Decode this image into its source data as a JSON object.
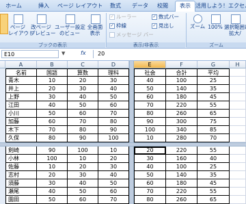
{
  "tabs": [
    "ホーム",
    "挿入",
    "ページ レイアウト",
    "数式",
    "データ",
    "校閲",
    "表示",
    "活用しよう！エクセル"
  ],
  "ribbon": {
    "view_buttons": [
      "標準",
      "ページ\nレイアウト",
      "改ページ\nプレビュー",
      "ユーザー設定\nのビュー",
      "全画面\n表示"
    ],
    "group_book_view": "ブックの表示",
    "checkboxes_left": [
      "ルーラー",
      "枠線",
      "メッセージ バー"
    ],
    "checkboxes_right": [
      "数式バー",
      "見出し"
    ],
    "group_show_hide": "表示/非表示",
    "zoom_buttons": [
      "ズーム",
      "100%",
      "選択範囲に\n拡大/"
    ],
    "group_zoom": "ズーム"
  },
  "formula": {
    "namebox": "E10",
    "fx": "fx",
    "value": "20"
  },
  "columns": [
    "A",
    "B",
    "C",
    "D",
    "E",
    "F",
    "G",
    "H"
  ],
  "header_row": {
    "A": "名前",
    "B": "国語",
    "C": "算数",
    "D": "理科",
    "E": "社会",
    "F": "合計",
    "G": "平均"
  },
  "rows_top": [
    [
      "青木",
      "10",
      "20",
      "30",
      "40",
      "100",
      "25"
    ],
    [
      "井上",
      "20",
      "30",
      "40",
      "50",
      "140",
      "35"
    ],
    [
      "上野",
      "30",
      "40",
      "50",
      "60",
      "180",
      "45"
    ],
    [
      "江田",
      "40",
      "50",
      "60",
      "70",
      "220",
      "55"
    ],
    [
      "小川",
      "50",
      "60",
      "70",
      "80",
      "260",
      "65"
    ],
    [
      "加藤",
      "60",
      "70",
      "80",
      "90",
      "300",
      "75"
    ],
    [
      "木下",
      "70",
      "80",
      "90",
      "100",
      "340",
      "85"
    ],
    [
      "久保",
      "80",
      "90",
      "100",
      "10",
      "280",
      "70"
    ]
  ],
  "rows_bottom": [
    [
      "剣崎",
      "90",
      "100",
      "10",
      "20",
      "220",
      "55"
    ],
    [
      "小林",
      "100",
      "10",
      "20",
      "30",
      "160",
      "40"
    ],
    [
      "佐藤",
      "10",
      "20",
      "30",
      "40",
      "100",
      "25"
    ],
    [
      "志村",
      "20",
      "30",
      "40",
      "50",
      "140",
      "35"
    ],
    [
      "須藤",
      "30",
      "40",
      "50",
      "60",
      "180",
      "45"
    ],
    [
      "瀬尾",
      "40",
      "50",
      "60",
      "70",
      "220",
      "55"
    ],
    [
      "園田",
      "50",
      "60",
      "70",
      "80",
      "260",
      "65"
    ]
  ]
}
